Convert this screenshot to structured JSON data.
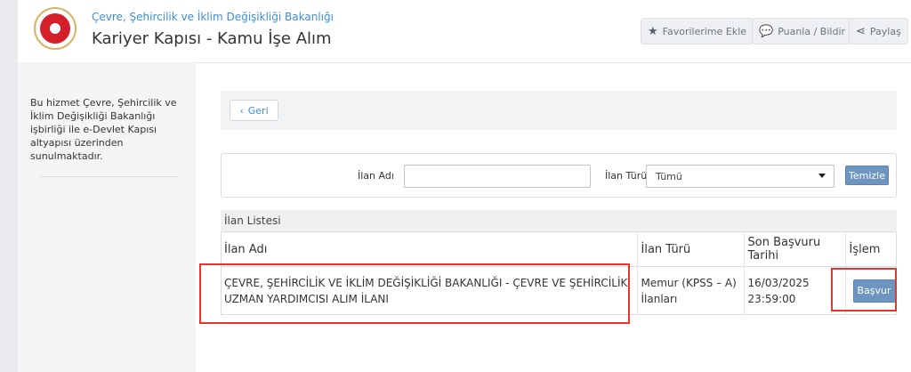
{
  "header": {
    "ministry": "Çevre, Şehircilik ve İklim Değişikliği Bakanlığı",
    "app_title": "Kariyer Kapısı - Kamu İşe Alım",
    "buttons": [
      {
        "label": "Favorilerime Ekle",
        "icon": "star-icon"
      },
      {
        "label": "Puanla / Bildir",
        "icon": "speech-bubble-icon"
      },
      {
        "label": "Paylaş",
        "icon": "share-icon"
      }
    ]
  },
  "sidebar": {
    "text": "Bu hizmet Çevre, Şehircilik ve İklim Değişikliği Bakanlığı işbirliği ile e-Devlet Kapısı altyapısı üzerinden sunulmaktadır."
  },
  "back": {
    "label": "Geri"
  },
  "filter": {
    "ilan_adi_label": "İlan Adı",
    "ilan_adi_value": "",
    "ilan_turu_label": "İlan Türü",
    "ilan_turu_selected": "Tümü",
    "clear_label": "Temizle"
  },
  "list": {
    "title": "İlan Listesi",
    "columns": [
      "İlan Adı",
      "İlan Türü",
      "Son Başvuru Tarihi",
      "İşlem"
    ],
    "rows": [
      {
        "name": "ÇEVRE, ŞEHİRCİLİK VE İKLİM DEĞİŞİKLİĞİ BAKANLIĞI - ÇEVRE VE ŞEHİRCİLİK UZMAN YARDIMCISI ALIM İLANI",
        "type": "Memur (KPSS – A) İlanları",
        "deadline": "16/03/2025 23:59:00",
        "action": "Başvur"
      }
    ]
  },
  "colors": {
    "accent": "#3d8ed8",
    "button_blue": "#6e95bf",
    "highlight": "#e8352b"
  }
}
